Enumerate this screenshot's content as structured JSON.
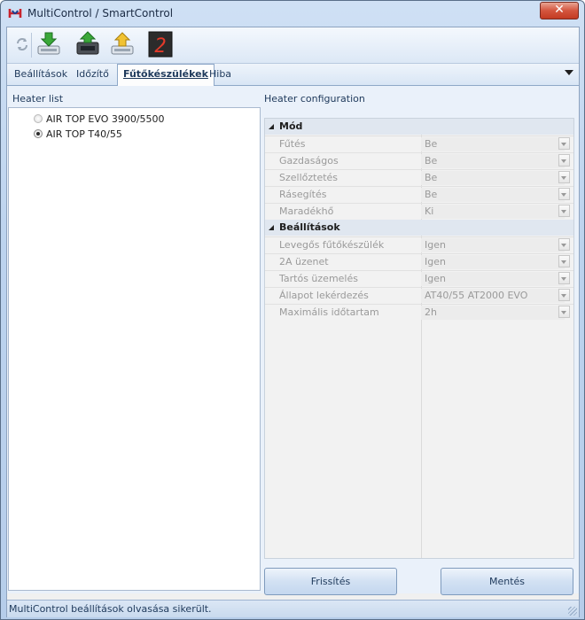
{
  "window": {
    "title": "MultiControl / SmartControl",
    "close_label": "✕"
  },
  "toolbar": {
    "buttons": [
      {
        "icon": "refresh-icon"
      },
      {
        "icon": "download-green-arrow-icon"
      },
      {
        "icon": "device-upload-icon"
      },
      {
        "icon": "upload-yellow-arrow-icon"
      },
      {
        "icon": "seven-segment-display-icon",
        "display_digit": "2"
      }
    ]
  },
  "tabs": [
    {
      "label": "Beállítások"
    },
    {
      "label": "Időzítő"
    },
    {
      "label": "Fűtőkészülékek",
      "active": true
    },
    {
      "label": "Hiba"
    }
  ],
  "heater_list": {
    "label": "Heater list",
    "items": [
      {
        "label": "AIR TOP EVO 3900/5500",
        "checked": false,
        "enabled": false
      },
      {
        "label": "AIR TOP T40/55",
        "checked": true,
        "enabled": true
      }
    ]
  },
  "config": {
    "label": "Heater configuration",
    "categories": [
      {
        "name": "Mód",
        "props": [
          {
            "name": "Fűtés",
            "value": "Be"
          },
          {
            "name": "Gazdaságos",
            "value": "Be"
          },
          {
            "name": "Szellőztetés",
            "value": "Be"
          },
          {
            "name": "Rásegítés",
            "value": "Be"
          },
          {
            "name": "Maradékhő",
            "value": "Ki"
          }
        ]
      },
      {
        "name": "Beállítások",
        "props": [
          {
            "name": "Levegős fűtőkészülék",
            "value": "Igen"
          },
          {
            "name": "2A üzenet",
            "value": "Igen"
          },
          {
            "name": "Tartós üzemelés",
            "value": "Igen"
          },
          {
            "name": "Állapot lekérdezés",
            "value": "AT40/55 AT2000 EVO"
          },
          {
            "name": "Maximális időtartam",
            "value": "2h"
          }
        ]
      }
    ]
  },
  "buttons": {
    "refresh_label": "Frissítés",
    "save_label": "Mentés"
  },
  "status": {
    "text": "MultiControl beállítások olvasása sikerült."
  },
  "colors": {
    "accent": "#1e395b",
    "title_bar": "#bcd3ee",
    "close": "#c33a22"
  }
}
